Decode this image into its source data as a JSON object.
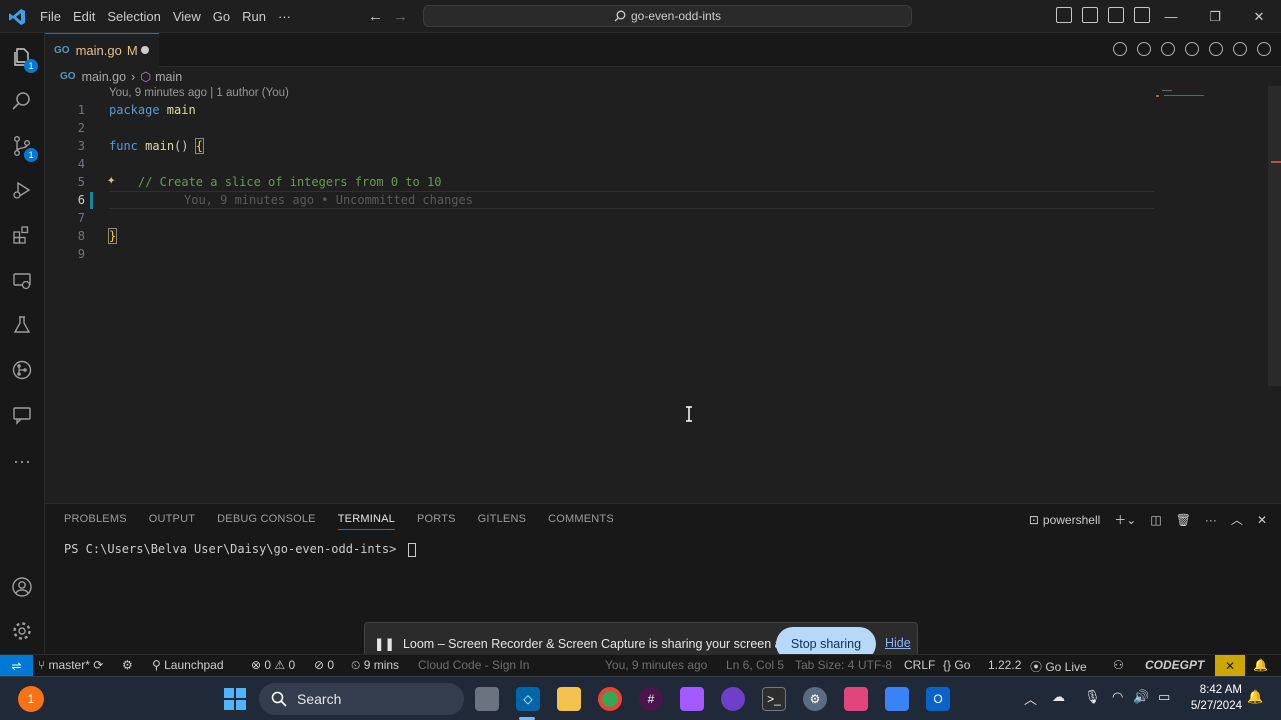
{
  "menu": [
    "File",
    "Edit",
    "Selection",
    "View",
    "Go",
    "Run",
    "···"
  ],
  "command_center": "go-even-odd-ints",
  "activity_badges": {
    "explorer": "1",
    "scm": "1"
  },
  "tab": {
    "file": "main.go",
    "status": "M"
  },
  "breadcrumb": {
    "file": "main.go",
    "symbol": "main"
  },
  "codelens": "You, 9 minutes ago | 1 author (You)",
  "lines": [
    "1",
    "2",
    "3",
    "4",
    "5",
    "6",
    "7",
    "8",
    "9"
  ],
  "code": {
    "l1_kw": "package",
    "l1_rest": " main",
    "l3_kw": "func",
    "l3_fn": "main",
    "l3_rest": "() ",
    "l3_brace": "{",
    "l5": "// Create a slice of integers from 0 to 10",
    "l6_blame": "You, 9 minutes ago • Uncommitted changes",
    "l8_brace": "}"
  },
  "panel": {
    "tabs": [
      "PROBLEMS",
      "OUTPUT",
      "DEBUG CONSOLE",
      "TERMINAL",
      "PORTS",
      "GITLENS",
      "COMMENTS"
    ],
    "active_tab": "TERMINAL",
    "shell": "powershell",
    "prompt": "PS C:\\Users\\Belva User\\Daisy\\go-even-odd-ints> "
  },
  "loom": {
    "message": "Loom – Screen Recorder & Screen Capture is sharing your screen and audio.",
    "stop": "Stop sharing",
    "hide": "Hide"
  },
  "status": {
    "branch": "master*",
    "launchpad": "Launchpad",
    "problems": "⊗ 0 ⚠ 0",
    "ports": "0",
    "time": "9 mins",
    "cloud": "Cloud Code - Sign In",
    "blame": "You, 9 minutes ago",
    "position": "Ln 6, Col 5",
    "tab_size": "Tab Size: 4",
    "encoding": "UTF-8",
    "eol": "CRLF",
    "language": "Go",
    "go_version": "1.22.2",
    "go_live": "Go Live",
    "codegpt": "CODEGPT"
  },
  "taskbar": {
    "search": "Search",
    "time": "8:42 AM",
    "date": "5/27/2024"
  },
  "colors": {
    "accent": "#0078d4",
    "modified": "#e2c08d",
    "keyword": "#569cd6",
    "function": "#dcdcaa",
    "comment": "#6a9955"
  }
}
